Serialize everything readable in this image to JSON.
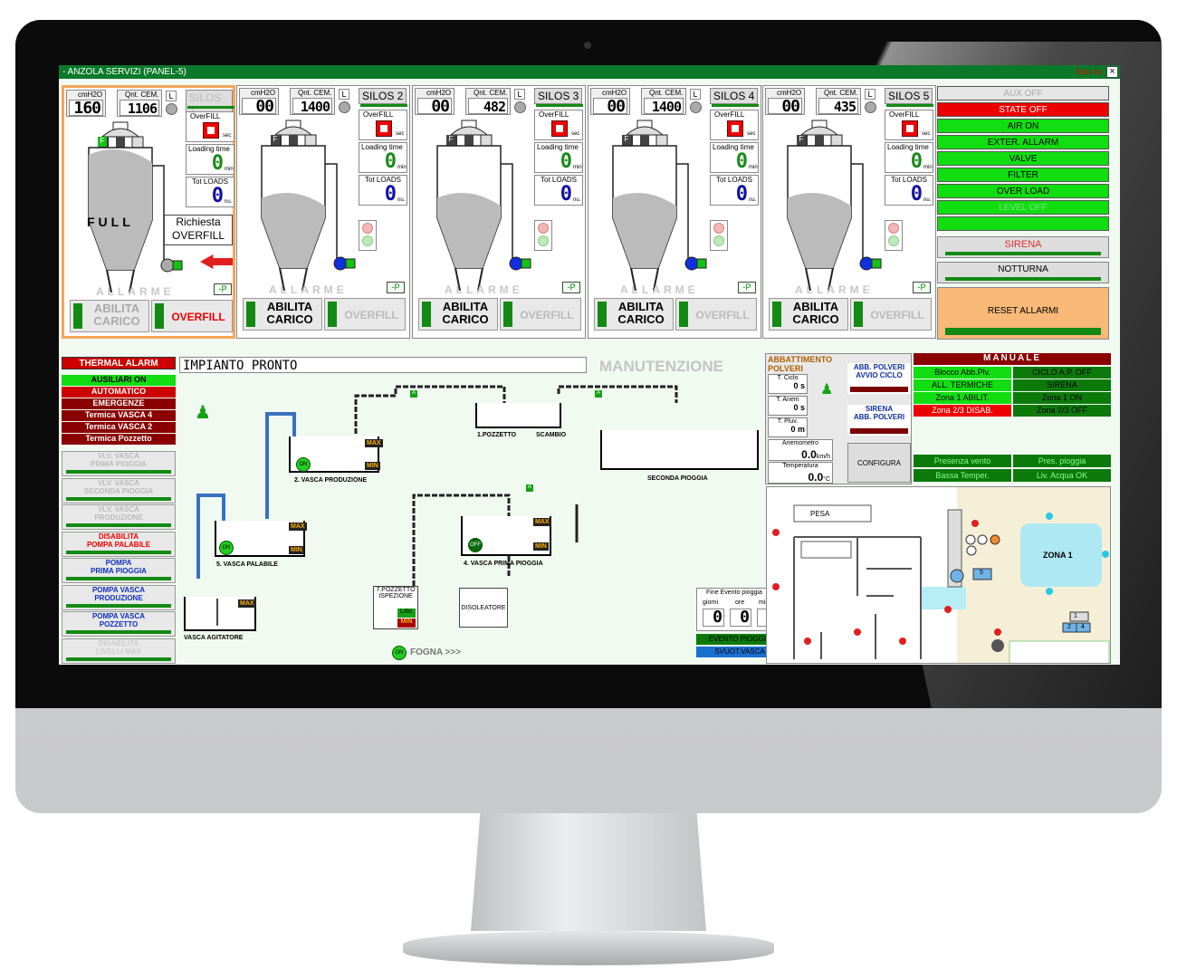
{
  "window": {
    "title": "- ANZOLA SERVIZI (PANEL-5)",
    "right_text": "Esci xx",
    "close": "×"
  },
  "silos": [
    {
      "tag": "SILOS 1",
      "cm": "160",
      "qnt": "1106",
      "loads_state": "FULL",
      "overfill": "OVERFILL",
      "richiesta": [
        "Richiesta",
        "OVERFILL"
      ]
    },
    {
      "tag": "SILOS 2",
      "cm": "00",
      "qnt": "1400",
      "overfill": "OVERFILL"
    },
    {
      "tag": "SILOS 3",
      "cm": "00",
      "qnt": "482",
      "overfill": "OVERFILL"
    },
    {
      "tag": "SILOS 4",
      "cm": "00",
      "qnt": "1400",
      "overfill": "OVERFILL"
    },
    {
      "tag": "SILOS 5",
      "cm": "00",
      "qnt": "435",
      "overfill": "OVERFILL"
    }
  ],
  "silo_common": {
    "cmh2o": "cmH2O",
    "qnt_cem": "Qnt. CEM.",
    "l": "L",
    "overfill_lbl": "OverFILL",
    "sec": "sec",
    "loading_time": "Loading time",
    "min": "min",
    "tot_loads": "Tot LOADS",
    "nu": "nu.",
    "zero": "0",
    "f": "F",
    "p": "-P",
    "allarme": "ALLARME",
    "abilita": [
      "ABILITA",
      "CARICO"
    ]
  },
  "status": {
    "items": [
      "AUX OFF",
      "STATE OFF",
      "AIR ON",
      "EXTER. ALLARM",
      "VALVE",
      "FILTER",
      "OVER LOAD",
      "LEVEL OFF"
    ],
    "sirena": "SIRENA",
    "notturna": "NOTTURNA",
    "reset": "RESET ALLARMI"
  },
  "thermal": {
    "title": "THERMAL ALARM",
    "items": [
      "AUSILIARI ON",
      "AUTOMATICO",
      "EMERGENZE",
      "Termica VASCA 4",
      "Termica VASCA 2",
      "Termica Pozzetto"
    ],
    "buttons": [
      [
        "VLV. VASCA",
        "PRIMA PIOGGIA"
      ],
      [
        "VLV. VASCA",
        "SECONDA PIOGGIA"
      ],
      [
        "VLV. VASCA",
        "PRODUZIONE"
      ],
      [
        "DISABILITA",
        "POMPA PALABILE"
      ],
      [
        "POMPA",
        "PRIMA PIOGGIA"
      ],
      [
        "POMPA VASCA",
        "PRODUZIONE"
      ],
      [
        "POMPA VASCA",
        "POZZETTO"
      ],
      [
        "DISABILITA",
        "LIVELLI MAX"
      ]
    ]
  },
  "impianto": {
    "status": "IMPIANTO PRONTO",
    "manut": "MANUTENZIONE"
  },
  "diagram": {
    "vasca_prod": "2. VASCA PRODUZIONE",
    "vasca_pal": "5. VASCA PALABILE",
    "vasca_agit": "VASCA AGITATORE",
    "pozzetto": "1.POZZETTO",
    "scambio": "SCAMBIO",
    "seconda": "SECONDA PIOGGIA",
    "prima": "4. VASCA PRIMA PIOGGIA",
    "insp": [
      "7.POZZETTO",
      "ISPEZIONE"
    ],
    "lav": "LAV.",
    "disoleatore": "DISOLEATORE",
    "fogna": "FOGNA >>>",
    "max": "MAX",
    "min": "MIN",
    "on": "ON",
    "off": "OFF",
    "a": "A",
    "m": "M",
    "evento_title": "Fine Evento pioggia",
    "giorni": "giorni",
    "ore": "ore",
    "minuti": "minuti",
    "evento": "EVENTO PIOGGIA",
    "svuot": "SVUOT.VASCA"
  },
  "abbattimento": {
    "title": [
      "ABBATTIMENTO",
      "POLVERI"
    ],
    "t_ciclo": "T. Ciclo",
    "t_ciclo_v": "0 s",
    "t_anem": "T. Anem",
    "t_anem_v": "0 s",
    "t_pluv": "T. Pluv.",
    "t_pluv_v": "0 m",
    "anemo": "Anemometro",
    "anemo_v": "0.0",
    "kmh": "km/h",
    "temp": "Temperatura",
    "temp_v": "0.0",
    "c": "°C",
    "abb": [
      "ABB. POLVERI",
      "AVVIO CICLO"
    ],
    "sirena": [
      "SIRENA",
      "ABB. POLVERI"
    ],
    "config": "CONFIGURA"
  },
  "manuale": {
    "title": "MANUALE",
    "rows": [
      [
        "Blocco Abb.Plv.",
        "CICLO A.P. OFF"
      ],
      [
        "ALL. TERMICHE",
        "SIRENA"
      ],
      [
        "Zona 1 ABILIT.",
        "Zona 1 ON"
      ],
      [
        "Zona 2/3 DISAB.",
        "Zona 2/3 OFF"
      ]
    ],
    "bottom": [
      [
        "Presenza vento",
        "Pres. pioggia"
      ],
      [
        "Bassa Temper.",
        "Liv. Acqua OK"
      ]
    ]
  },
  "map": {
    "pesa": "PESA",
    "zona1": "ZONA 1",
    "n": [
      "1",
      "2",
      "3",
      "4",
      "5",
      "6",
      "7"
    ]
  }
}
